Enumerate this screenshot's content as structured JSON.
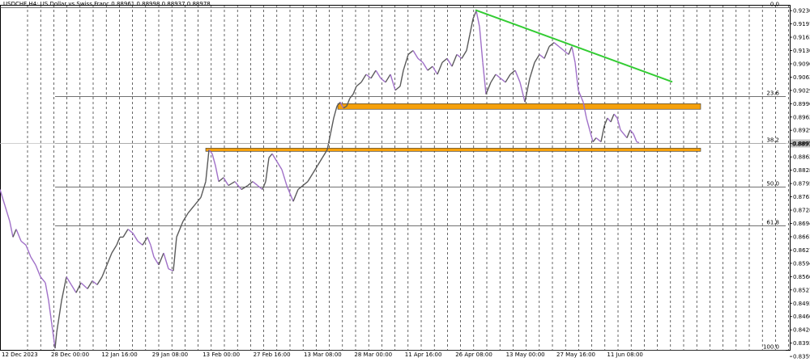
{
  "header": {
    "symbol": "USDCHF,H4:",
    "description": "US Dollar vs Swiss Franc",
    "ohlc": "0.88961 0.88998 0.88937 0.88978"
  },
  "colors": {
    "background": "#ffffff",
    "candle_up": "#5a5a5a",
    "candle_down": "#a070c8",
    "grid": "#000000",
    "trendline": "#33cc33",
    "zone": "#f5a00a",
    "fib_line": "#404040",
    "price_tag": "#c0c0c0"
  },
  "chart_data": {
    "type": "line",
    "title": "",
    "xlabel": "",
    "ylabel": "",
    "ylim": [
      0.8376,
      0.9245
    ],
    "grid": true,
    "x_ticks": [
      "12 Dec 2023",
      "28 Dec 00:00",
      "12 Jan 16:00",
      "29 Jan 08:00",
      "13 Feb 00:00",
      "27 Feb 16:00",
      "13 Mar 08:00",
      "28 Mar 00:00",
      "11 Apr 16:00",
      "26 Apr 08:00",
      "13 May 00:00",
      "27 May 16:00",
      "11 Jun 08:00"
    ],
    "y_ticks": [
      "0.92305",
      "0.91970",
      "0.91635",
      "0.91300",
      "0.90965",
      "0.90630",
      "0.90295",
      "0.89960",
      "0.89625",
      "0.89292",
      "0.88957",
      "0.88620",
      "0.88285",
      "0.87950",
      "0.87615",
      "0.87280",
      "0.86945",
      "0.86610",
      "0.86275",
      "0.85940",
      "0.85605",
      "0.85270",
      "0.84935",
      "0.84600",
      "0.84265",
      "0.83930",
      "0.83595"
    ],
    "current_price_label": "0.88978",
    "current_price": 0.88978,
    "series": [
      {
        "values": [
          [
            0,
            0.878
          ],
          [
            6,
            0.874
          ],
          [
            12,
            0.87
          ],
          [
            16,
            0.866
          ],
          [
            20,
            0.868
          ],
          [
            26,
            0.865
          ],
          [
            32,
            0.864
          ],
          [
            38,
            0.861
          ],
          [
            44,
            0.859
          ],
          [
            50,
            0.856
          ],
          [
            56,
            0.8545
          ],
          [
            60,
            0.85
          ],
          [
            64,
            0.844
          ],
          [
            68,
            0.838
          ],
          [
            70,
            0.842
          ],
          [
            76,
            0.85
          ],
          [
            82,
            0.856
          ],
          [
            88,
            0.854
          ],
          [
            94,
            0.852
          ],
          [
            100,
            0.8545
          ],
          [
            108,
            0.853
          ],
          [
            114,
            0.855
          ],
          [
            120,
            0.854
          ],
          [
            126,
            0.856
          ],
          [
            132,
            0.859
          ],
          [
            138,
            0.862
          ],
          [
            144,
            0.864
          ],
          [
            148,
            0.866
          ],
          [
            152,
            0.866
          ],
          [
            158,
            0.868
          ],
          [
            164,
            0.867
          ],
          [
            170,
            0.865
          ],
          [
            176,
            0.864
          ],
          [
            182,
            0.866
          ],
          [
            186,
            0.864
          ],
          [
            190,
            0.861
          ],
          [
            196,
            0.859
          ],
          [
            202,
            0.862
          ],
          [
            208,
            0.858
          ],
          [
            214,
            0.8575
          ],
          [
            218,
            0.866
          ],
          [
            226,
            0.87
          ],
          [
            232,
            0.872
          ],
          [
            240,
            0.874
          ],
          [
            248,
            0.876
          ],
          [
            254,
            0.88
          ],
          [
            258,
            0.888
          ],
          [
            262,
            0.887
          ],
          [
            266,
            0.884
          ],
          [
            270,
            0.88
          ],
          [
            276,
            0.881
          ],
          [
            282,
            0.879
          ],
          [
            290,
            0.88
          ],
          [
            298,
            0.878
          ],
          [
            306,
            0.879
          ],
          [
            312,
            0.88
          ],
          [
            318,
            0.879
          ],
          [
            324,
            0.878
          ],
          [
            328,
            0.88
          ],
          [
            332,
            0.886
          ],
          [
            336,
            0.887
          ],
          [
            342,
            0.885
          ],
          [
            348,
            0.883
          ],
          [
            354,
            0.879
          ],
          [
            358,
            0.877
          ],
          [
            362,
            0.875
          ],
          [
            368,
            0.878
          ],
          [
            374,
            0.879
          ],
          [
            380,
            0.88
          ],
          [
            386,
            0.882
          ],
          [
            392,
            0.884
          ],
          [
            398,
            0.886
          ],
          [
            404,
            0.888
          ],
          [
            408,
            0.892
          ],
          [
            412,
            0.896
          ],
          [
            416,
            0.899
          ],
          [
            420,
            0.9
          ],
          [
            424,
            0.8985
          ],
          [
            428,
            0.899
          ],
          [
            432,
            0.901
          ],
          [
            436,
            0.902
          ],
          [
            440,
            0.904
          ],
          [
            446,
            0.905
          ],
          [
            452,
            0.907
          ],
          [
            458,
            0.906
          ],
          [
            464,
            0.908
          ],
          [
            470,
            0.906
          ],
          [
            476,
            0.905
          ],
          [
            482,
            0.907
          ],
          [
            488,
            0.903
          ],
          [
            494,
            0.904
          ],
          [
            498,
            0.908
          ],
          [
            504,
            0.912
          ],
          [
            510,
            0.913
          ],
          [
            516,
            0.911
          ],
          [
            522,
            0.91
          ],
          [
            528,
            0.908
          ],
          [
            534,
            0.909
          ],
          [
            540,
            0.907
          ],
          [
            546,
            0.91
          ],
          [
            552,
            0.911
          ],
          [
            558,
            0.909
          ],
          [
            564,
            0.912
          ],
          [
            570,
            0.911
          ],
          [
            576,
            0.913
          ],
          [
            580,
            0.917
          ],
          [
            584,
            0.921
          ],
          [
            588,
            0.923
          ],
          [
            592,
            0.919
          ],
          [
            596,
            0.91
          ],
          [
            600,
            0.902
          ],
          [
            606,
            0.905
          ],
          [
            612,
            0.907
          ],
          [
            618,
            0.906
          ],
          [
            624,
            0.905
          ],
          [
            630,
            0.907
          ],
          [
            636,
            0.908
          ],
          [
            642,
            0.905
          ],
          [
            648,
            0.9
          ],
          [
            654,
            0.906
          ],
          [
            660,
            0.91
          ],
          [
            666,
            0.912
          ],
          [
            672,
            0.911
          ],
          [
            678,
            0.914
          ],
          [
            684,
            0.915
          ],
          [
            690,
            0.914
          ],
          [
            696,
            0.913
          ],
          [
            702,
            0.912
          ],
          [
            706,
            0.914
          ],
          [
            710,
            0.91
          ],
          [
            714,
            0.903
          ],
          [
            720,
            0.9
          ],
          [
            724,
            0.896
          ],
          [
            728,
            0.893
          ],
          [
            732,
            0.89
          ],
          [
            736,
            0.891
          ],
          [
            742,
            0.89
          ],
          [
            746,
            0.894
          ],
          [
            750,
            0.896
          ],
          [
            754,
            0.895
          ],
          [
            758,
            0.897
          ],
          [
            762,
            0.896
          ],
          [
            766,
            0.893
          ],
          [
            770,
            0.892
          ],
          [
            774,
            0.891
          ],
          [
            778,
            0.893
          ],
          [
            782,
            0.892
          ],
          [
            786,
            0.89
          ],
          [
            789,
            0.8898
          ]
        ]
      }
    ],
    "trendline": {
      "from": [
        587,
        0.9232
      ],
      "to": [
        830,
        0.9051
      ]
    },
    "zones": [
      {
        "x1": 417,
        "x2": 865,
        "y_top": 0.8996,
        "y_bottom": 0.8982
      },
      {
        "x1": 254,
        "x2": 865,
        "y_top": 0.8884,
        "y_bottom": 0.8876
      }
    ],
    "fib_levels": [
      {
        "label": "0.0",
        "price": 0.9238,
        "x1": 0,
        "x2": 975
      },
      {
        "label": "23.6",
        "price": 0.9015,
        "x1": 68,
        "x2": 970
      },
      {
        "label": "38.2",
        "price": 0.8896,
        "x1": 68,
        "x2": 970
      },
      {
        "label": "50.0",
        "price": 0.8788,
        "x1": 68,
        "x2": 970
      },
      {
        "label": "61.8",
        "price": 0.8689,
        "x1": 68,
        "x2": 970
      },
      {
        "label": "100.0",
        "price": 0.8376,
        "x1": 68,
        "x2": 970
      }
    ]
  }
}
